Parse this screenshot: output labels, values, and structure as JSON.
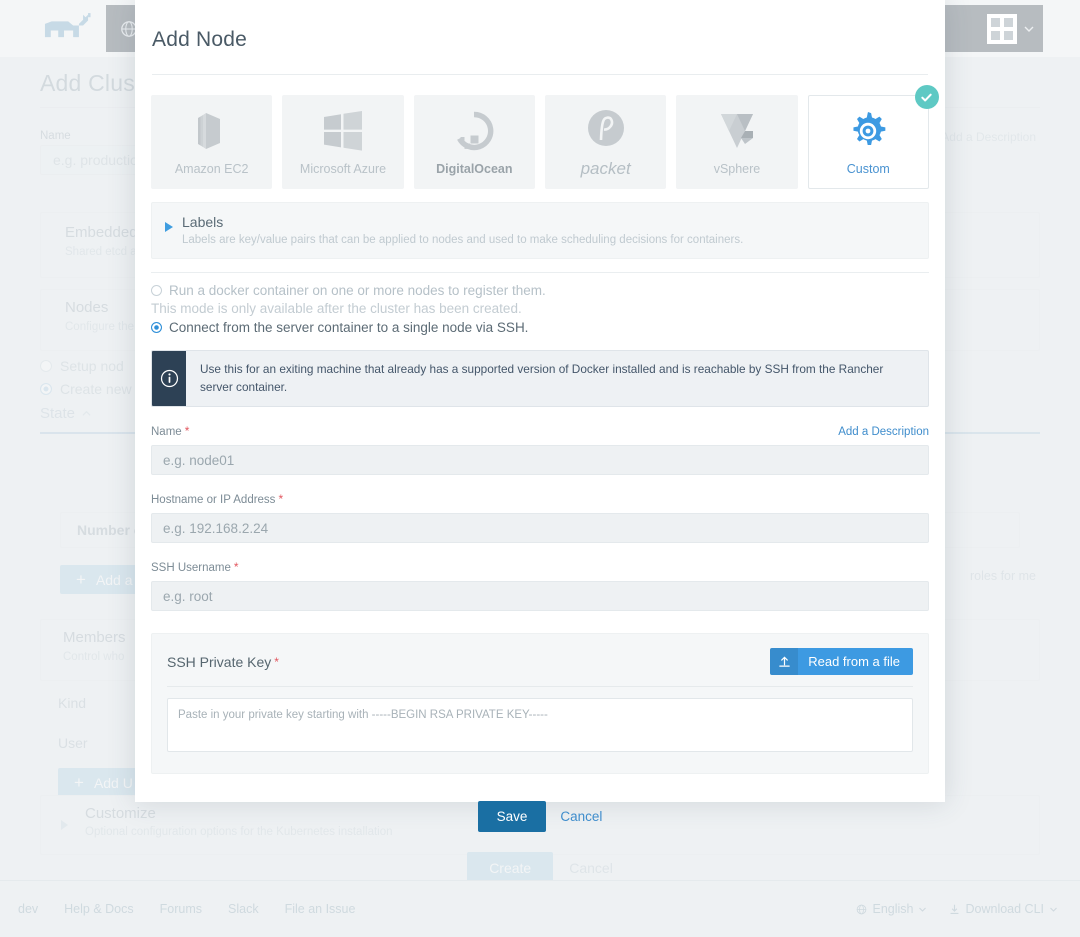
{
  "background": {
    "logo_icon": "rancher-cow-logo",
    "nav": {
      "left_button_icon": "globe-icon",
      "right_button_icon": "puzzle-piece-icon",
      "right_button_caret": "chevron-down-icon"
    },
    "page_title": "Add Cluster",
    "name_label": "Name",
    "name_placeholder": "e.g. production",
    "add_description_link": "Add a Description",
    "embedded_title": "Embedded",
    "embedded_sub": "Shared etcd and",
    "nodes_title": "Nodes",
    "nodes_sub": "Configure the",
    "radio_setup": "Setup nod",
    "radio_create": "Create new",
    "state_label": "State",
    "number_of_label": "Number o",
    "add_a_button": "Add a",
    "members_title": "Members",
    "members_sub": "Control who",
    "kind_label": "Kind",
    "user_label": "User",
    "add_user_button": "Add U",
    "customize_title": "Customize",
    "customize_sub": "Optional configuration options for the Kubernetes installation",
    "roles_text": "roles for me",
    "create_button": "Create",
    "cancel_button": "Cancel"
  },
  "footer": {
    "links": [
      "dev",
      "Help & Docs",
      "Forums",
      "Slack",
      "File an Issue"
    ],
    "language": "English",
    "language_icon": "globe-icon",
    "language_caret": "chevron-down-icon",
    "download_cli": "Download CLI",
    "download_icon": "download-icon",
    "download_caret": "chevron-down-icon"
  },
  "modal": {
    "title": "Add Node",
    "providers": [
      {
        "id": "amazon-ec2",
        "label": "Amazon EC2",
        "icon": "aws-ec2-icon",
        "selected": false
      },
      {
        "id": "microsoft-azure",
        "label": "Microsoft Azure",
        "icon": "windows-icon",
        "selected": false
      },
      {
        "id": "digitalocean",
        "label": "DigitalOcean",
        "icon": "digitalocean-icon",
        "selected": false
      },
      {
        "id": "packet",
        "label": "packet",
        "icon": "packet-icon",
        "selected": false
      },
      {
        "id": "vsphere",
        "label": "vSphere",
        "icon": "vsphere-icon",
        "selected": false
      },
      {
        "id": "custom",
        "label": "Custom",
        "icon": "gear-icon",
        "selected": true
      }
    ],
    "selected_badge_icon": "check-icon",
    "labels_section": {
      "expander_icon": "triangle-right-icon",
      "title": "Labels",
      "description": "Labels are key/value pairs that can be applied to nodes and used to make scheduling decisions for containers."
    },
    "mode_options": [
      {
        "id": "docker-register",
        "label": "Run a docker container on one or more nodes to register them.",
        "selected": false,
        "disabled": true
      },
      {
        "id": "ssh-single-node",
        "label": "Connect from the server container to a single node via SSH.",
        "selected": true,
        "disabled": false
      }
    ],
    "mode_note": "This mode is only available after the cluster has been created.",
    "info_banner": {
      "icon": "info-icon",
      "text": "Use this for an exiting machine that already has a supported version of Docker installed and is reachable by SSH from the Rancher server container."
    },
    "fields": [
      {
        "id": "name",
        "label": "Name",
        "required": true,
        "placeholder": "e.g. node01",
        "value": "",
        "link": "Add a Description"
      },
      {
        "id": "hostname",
        "label": "Hostname or IP Address",
        "required": true,
        "placeholder": "e.g. 192.168.2.24",
        "value": "",
        "link": ""
      },
      {
        "id": "ssh-user",
        "label": "SSH Username",
        "required": true,
        "placeholder": "e.g. root",
        "value": "",
        "link": ""
      }
    ],
    "ssh_key": {
      "title": "SSH Private Key",
      "required": true,
      "read_button_label": "Read from a file",
      "read_button_icon": "upload-icon",
      "placeholder": "Paste in your private key starting with -----BEGIN RSA PRIVATE KEY-----",
      "value": ""
    },
    "save_label": "Save",
    "cancel_label": "Cancel"
  },
  "colors": {
    "accent_blue": "#3d9ae2",
    "save_blue": "#1a6fa3",
    "badge_teal": "#5ec9c4",
    "required_red": "#e2575f",
    "banner_dark": "#2d4155",
    "page_bg": "#eef1f3"
  }
}
